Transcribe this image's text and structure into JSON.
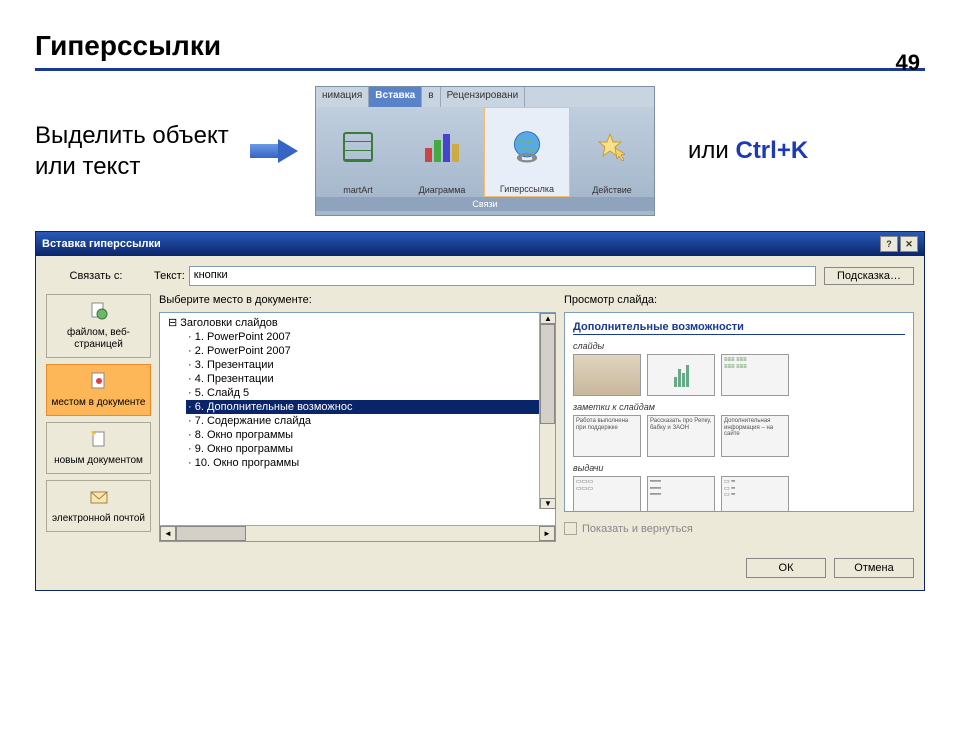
{
  "page_number": "49",
  "slide_title": "Гиперссылки",
  "instruction": "Выделить объект или текст",
  "or_label": "или ",
  "shortcut": "Ctrl+K",
  "ribbon": {
    "tabs": [
      "нимация",
      "Вставка",
      "в",
      "Рецензировани"
    ],
    "active_index": 1,
    "items": [
      {
        "label": "martArt"
      },
      {
        "label": "Диаграмма"
      },
      {
        "label": "Гиперссылка"
      },
      {
        "label": "Действие"
      }
    ],
    "group": "Связи"
  },
  "dialog": {
    "title": "Вставка гиперссылки",
    "link_with_label": "Связать с:",
    "text_label": "Текст:",
    "text_value": "кнопки",
    "hint_button": "Подсказка…",
    "link_targets": [
      "файлом, веб-страницей",
      "местом в документе",
      "новым документом",
      "электронной почтой"
    ],
    "selected_target_index": 1,
    "select_place_label": "Выберите место в документе:",
    "tree_root": "Заголовки слайдов",
    "tree_items": [
      "1. PowerPoint 2007",
      "2. PowerPoint 2007",
      "3. Презентации",
      "4. Презентации",
      "5. Слайд 5",
      "6. Дополнительные возможнос",
      "7. Содержание слайда",
      "8. Окно программы",
      "9. Окно программы",
      "10. Окно программы"
    ],
    "selected_tree_index": 5,
    "preview_label": "Просмотр слайда:",
    "preview_title": "Дополнительные возможности",
    "preview_sections": [
      "слайды",
      "заметки к слайдам",
      "выдачи"
    ],
    "preview_thumb_text": [
      "Работа выполнена при поддержке",
      "Рассказать про Репку, бабку и ЗАОН",
      "Дополнительная информация – на сайте"
    ],
    "show_and_return": "Показать и вернуться",
    "ok": "ОК",
    "cancel": "Отмена"
  }
}
